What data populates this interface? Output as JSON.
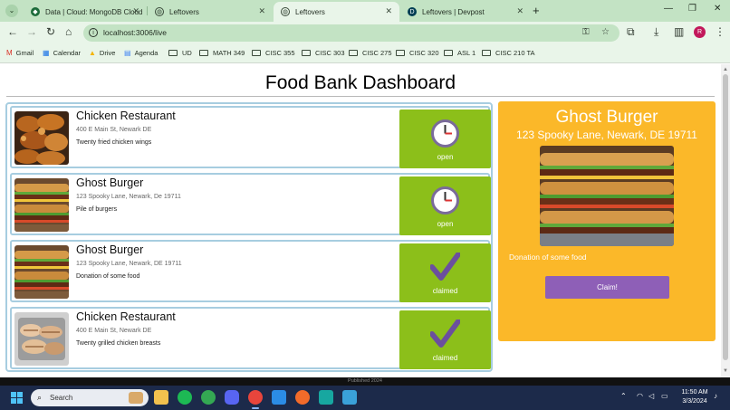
{
  "browser": {
    "tabs": [
      {
        "title": "Data | Cloud: MongoDB Cloud",
        "icon": "mongodb-leaf-icon"
      },
      {
        "title": "Leftovers",
        "icon": "globe-icon"
      },
      {
        "title": "Leftovers",
        "icon": "globe-icon",
        "active": true
      },
      {
        "title": "Leftovers | Devpost",
        "icon": "devpost-icon"
      }
    ],
    "url": "localhost:3006/live",
    "profile_initial": "R",
    "bookmarks": [
      {
        "label": "Gmail",
        "icon": "gmail-icon"
      },
      {
        "label": "Calendar",
        "icon": "calendar-icon"
      },
      {
        "label": "Drive",
        "icon": "drive-icon"
      },
      {
        "label": "Agenda",
        "icon": "agenda-icon"
      },
      {
        "label": "UD",
        "icon": "folder-icon"
      },
      {
        "label": "MATH 349",
        "icon": "folder-icon"
      },
      {
        "label": "CISC 355",
        "icon": "folder-icon"
      },
      {
        "label": "CISC 303",
        "icon": "folder-icon"
      },
      {
        "label": "CISC 275",
        "icon": "folder-icon"
      },
      {
        "label": "CISC 320",
        "icon": "folder-icon"
      },
      {
        "label": "ASL 1",
        "icon": "folder-icon"
      },
      {
        "label": "CISC 210 TA",
        "icon": "folder-icon"
      }
    ]
  },
  "page": {
    "title": "Food Bank Dashboard",
    "listings": [
      {
        "name": "Chicken Restaurant",
        "address": "400 E Main St, Newark DE",
        "description": "Twenty fried chicken wings",
        "status": "open",
        "status_icon": "clock-icon",
        "image": "fried-chicken-wings"
      },
      {
        "name": "Ghost Burger",
        "address": "123 Spooky Lane, Newark, De 19711",
        "description": "Pile of burgers",
        "status": "open",
        "status_icon": "clock-icon",
        "image": "burger-pile"
      },
      {
        "name": "Ghost Burger",
        "address": "123 Spooky Lane, Newark, DE 19711",
        "description": "Donation of some food",
        "status": "claimed",
        "status_icon": "checkmark-icon",
        "image": "burger-pile"
      },
      {
        "name": "Chicken Restaurant",
        "address": "400 E Main St, Newark DE",
        "description": "Twenty grilled chicken breasts",
        "status": "claimed",
        "status_icon": "checkmark-icon",
        "image": "grilled-chicken-tray"
      }
    ],
    "detail": {
      "name": "Ghost Burger",
      "address": "123 Spooky Lane, Newark, DE 19711",
      "description": "Donation of some food",
      "button_label": "Claim!"
    },
    "footer": "Published 2024",
    "colors": {
      "status_green": "#8cbf1a",
      "detail_orange": "#fbb829",
      "claim_purple": "#8e5fb7",
      "card_border": "#a7cde0"
    }
  },
  "taskbar": {
    "search_label": "Search",
    "time": "11:50 AM",
    "date": "3/3/2024"
  }
}
